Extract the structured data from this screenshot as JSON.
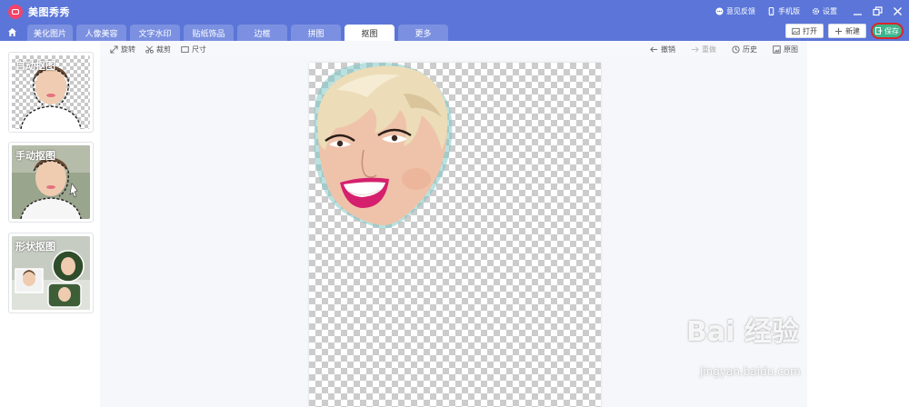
{
  "app": {
    "title": "美图秀秀"
  },
  "top_links": [
    {
      "label": "意见反馈",
      "icon": "chat-icon"
    },
    {
      "label": "手机版",
      "icon": "phone-icon"
    },
    {
      "label": "设置",
      "icon": "gear-icon"
    }
  ],
  "tabs": [
    {
      "label": "美化图片",
      "active": false
    },
    {
      "label": "人像美容",
      "active": false
    },
    {
      "label": "文字水印",
      "active": false
    },
    {
      "label": "贴纸饰品",
      "active": false
    },
    {
      "label": "边框",
      "active": false
    },
    {
      "label": "拼图",
      "active": false
    },
    {
      "label": "抠图",
      "active": true
    },
    {
      "label": "更多",
      "active": false
    }
  ],
  "actions": {
    "open_label": "打开",
    "new_label": "新建",
    "save_label": "保存"
  },
  "toolbar": {
    "rotate_label": "旋转",
    "crop_label": "裁剪",
    "size_label": "尺寸",
    "undo_label": "撤销",
    "redo_label": "重做",
    "history_label": "历史",
    "original_label": "原图"
  },
  "cutout_modes": [
    {
      "label": "自动抠图"
    },
    {
      "label": "手动抠图"
    },
    {
      "label": "形状抠图"
    }
  ],
  "watermark": {
    "text": "Bai 经验",
    "sub": "jingyan.baidu.com"
  },
  "colors": {
    "title_bar": "#5b76d8",
    "save_button": "#3cb68e",
    "highlight_ring": "#d8262b"
  }
}
